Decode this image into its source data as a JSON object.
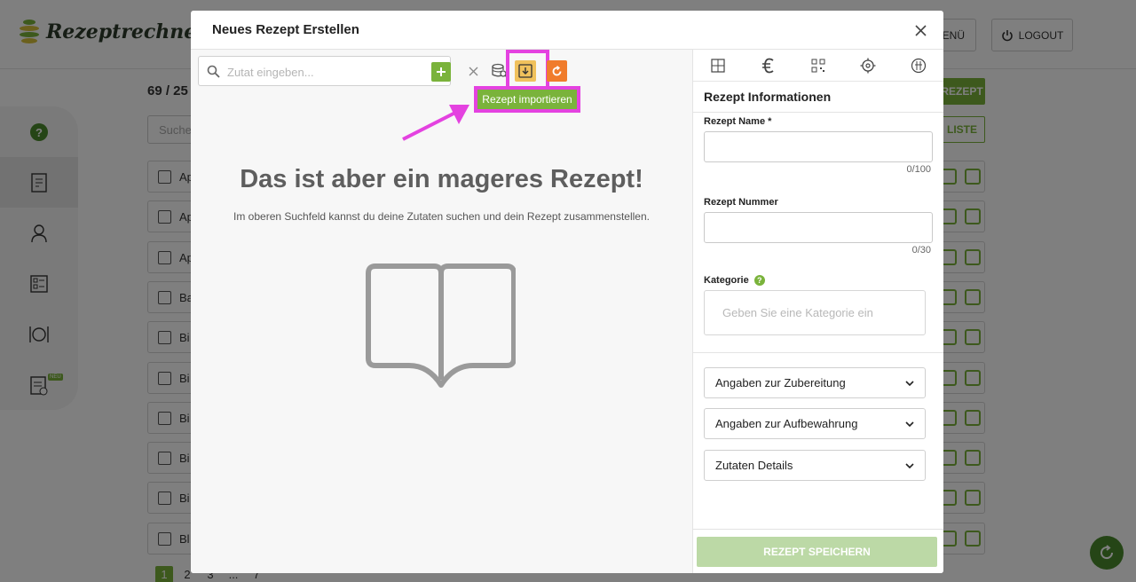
{
  "app": {
    "brand": "Rezeptrechner",
    "menu_label": "MENÜ",
    "logout_label": "LOGOUT",
    "recipe_count": "69 / 25",
    "search_placeholder": "Suche",
    "new_recipe_label": "REZEPT",
    "list_label": "LISTE",
    "rows": [
      "Ap",
      "Ap",
      "Ap",
      "Ba",
      "Bi",
      "Bi",
      "Bi",
      "Bi",
      "Bi",
      "Bl"
    ],
    "pagination": [
      "1",
      "2",
      "3",
      "...",
      "7"
    ],
    "new_badge": "NEU"
  },
  "modal": {
    "title": "Neues Rezept Erstellen",
    "search_placeholder": "Zutat eingeben...",
    "import_tooltip": "Rezept importieren",
    "empty_title": "Das ist aber ein mageres Rezept!",
    "empty_subtitle": "Im oberen Suchfeld kannst du deine Zutaten suchen und dein Rezept zusammenstellen.",
    "info": {
      "section_title": "Rezept Informationen",
      "name_label": "Rezept Name *",
      "name_value": "",
      "name_counter": "0/100",
      "number_label": "Rezept Nummer",
      "number_value": "",
      "number_counter": "0/30",
      "category_label": "Kategorie",
      "category_help": "?",
      "category_placeholder": "Geben Sie eine Kategorie ein"
    },
    "accordions": [
      "Angaben zur Zubereitung",
      "Angaben zur Aufbewahrung",
      "Zutaten Details"
    ],
    "save_label": "REZEPT SPEICHERN"
  },
  "colors": {
    "brand_green": "#7ab33b",
    "import_yellow": "#f0c15c",
    "refresh_orange": "#f07c2c",
    "highlight_magenta": "#e442e0"
  }
}
